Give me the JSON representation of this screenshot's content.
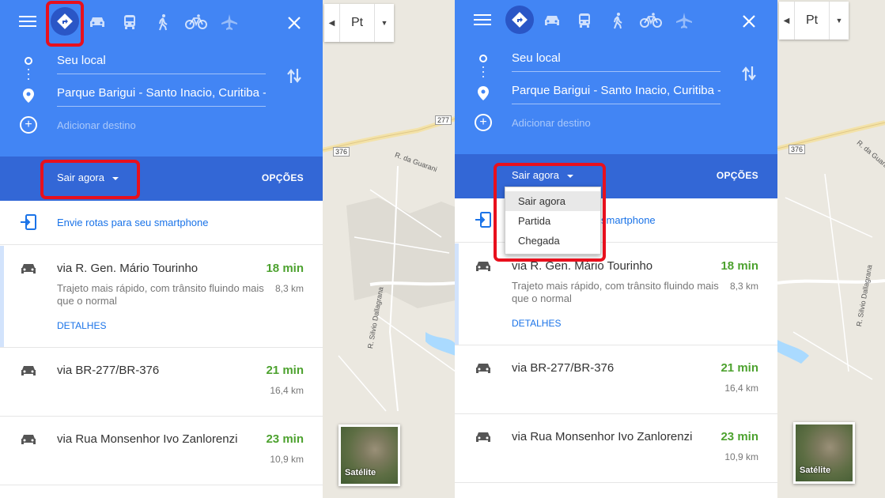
{
  "panel": {
    "origin": "Seu local",
    "destination": "Parque Barigui - Santo Inacio, Curitiba -",
    "add_destination": "Adicionar destino",
    "depart_label": "Sair agora",
    "options_label": "OPÇÕES",
    "send_to_phone": "Envie rotas para seu smartphone",
    "send_to_phone_partial": "smartphone",
    "details_label": "DETALHES"
  },
  "routes": [
    {
      "name": "via R. Gen. Mário Tourinho",
      "time": "18 min",
      "distance": "8,3 km",
      "description": "Trajeto mais rápido, com trânsito fluindo mais que o normal"
    },
    {
      "name": "via BR-277/BR-376",
      "time": "21 min",
      "distance": "16,4 km"
    },
    {
      "name": "via Rua Monsenhor Ivo Zanlorenzi",
      "time": "23 min",
      "distance": "10,9 km"
    }
  ],
  "depart_options": [
    "Sair agora",
    "Partida",
    "Chegada"
  ],
  "map": {
    "language": "Pt",
    "satellite_label": "Satélite",
    "road_labels": {
      "r277": "277",
      "r376": "376",
      "guarani": "R. da Guarani",
      "silvio": "R. Silvio Dallagrana",
      "right_label": "R. da Guara"
    }
  },
  "icons": [
    "menu-icon",
    "directions-icon",
    "car-icon",
    "transit-icon",
    "walk-icon",
    "bicycle-icon",
    "flight-icon",
    "close-icon",
    "swap-icon",
    "add-icon",
    "send-to-phone-icon"
  ],
  "colors": {
    "header": "#4285f4",
    "subbar": "#3367d6",
    "time_green": "#4da22f",
    "link_blue": "#1a73e8",
    "highlight_red": "#e8101d"
  }
}
